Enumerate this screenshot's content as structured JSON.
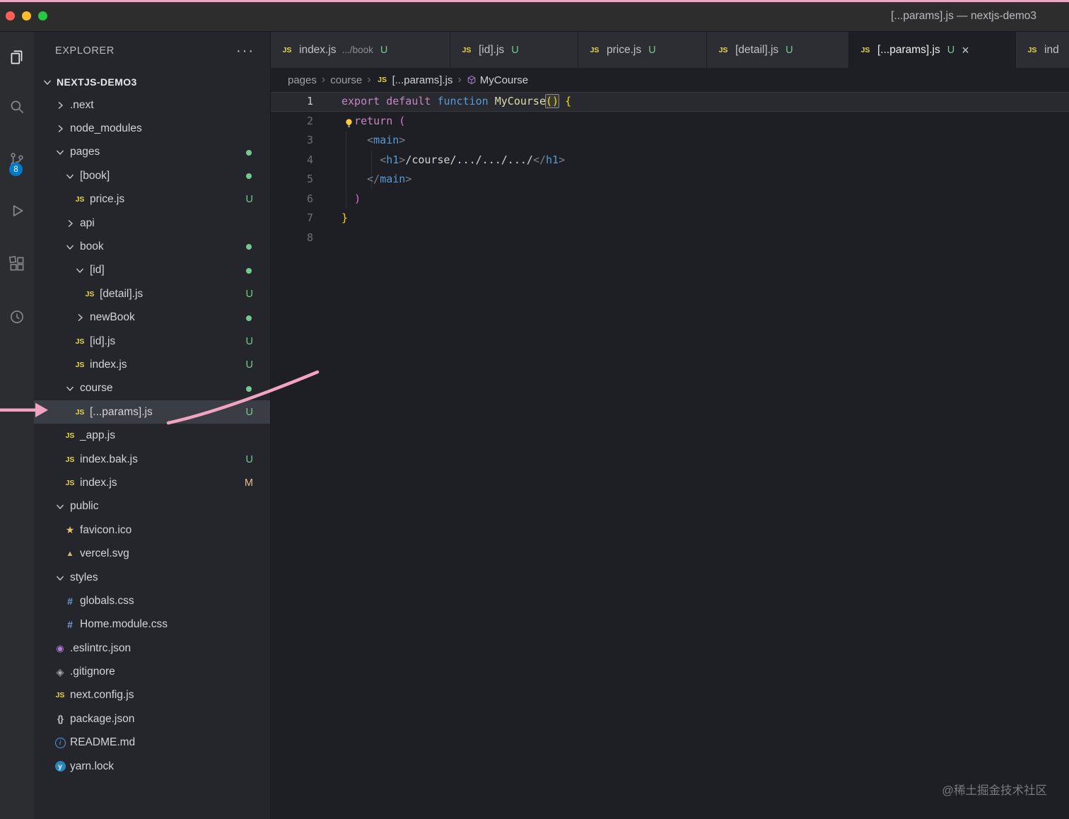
{
  "window": {
    "title": "[...params].js — nextjs-demo3"
  },
  "activity_bar": {
    "source_control_badge": "8",
    "items": [
      {
        "name": "explorer",
        "active": true
      },
      {
        "name": "search"
      },
      {
        "name": "source-control",
        "badge": "8"
      },
      {
        "name": "run-debug"
      },
      {
        "name": "extensions"
      },
      {
        "name": "history"
      }
    ]
  },
  "sidebar": {
    "header": "EXPLORER",
    "actions": "···",
    "root": {
      "label": "NEXTJS-DEMO3",
      "expanded": true
    },
    "items": [
      {
        "label": ".next",
        "level": 0,
        "type": "folder",
        "expanded": false
      },
      {
        "label": "node_modules",
        "level": 0,
        "type": "folder",
        "expanded": false
      },
      {
        "label": "pages",
        "level": 0,
        "type": "folder",
        "expanded": true,
        "dot": true
      },
      {
        "label": "[book]",
        "level": 1,
        "type": "folder",
        "expanded": true,
        "dot": true
      },
      {
        "label": "price.js",
        "level": 2,
        "type": "file",
        "icon": "js",
        "badge": "U"
      },
      {
        "label": "api",
        "level": 1,
        "type": "folder",
        "expanded": false
      },
      {
        "label": "book",
        "level": 1,
        "type": "folder",
        "expanded": true,
        "dot": true
      },
      {
        "label": "[id]",
        "level": 2,
        "type": "folder",
        "expanded": true,
        "dot": true
      },
      {
        "label": "[detail].js",
        "level": 3,
        "type": "file",
        "icon": "js",
        "badge": "U"
      },
      {
        "label": "newBook",
        "level": 2,
        "type": "folder",
        "expanded": false,
        "dot": true
      },
      {
        "label": "[id].js",
        "level": 2,
        "type": "file",
        "icon": "js",
        "badge": "U"
      },
      {
        "label": "index.js",
        "level": 2,
        "type": "file",
        "icon": "js",
        "badge": "U"
      },
      {
        "label": "course",
        "level": 1,
        "type": "folder",
        "expanded": true,
        "dot": true
      },
      {
        "label": "[...params].js",
        "level": 2,
        "type": "file",
        "icon": "js",
        "badge": "U",
        "selected": true
      },
      {
        "label": "_app.js",
        "level": 1,
        "type": "file",
        "icon": "js"
      },
      {
        "label": "index.bak.js",
        "level": 1,
        "type": "file",
        "icon": "js",
        "badge": "U"
      },
      {
        "label": "index.js",
        "level": 1,
        "type": "file",
        "icon": "js",
        "badge": "M"
      },
      {
        "label": "public",
        "level": 0,
        "type": "folder",
        "expanded": true
      },
      {
        "label": "favicon.ico",
        "level": 1,
        "type": "file",
        "icon": "star"
      },
      {
        "label": "vercel.svg",
        "level": 1,
        "type": "file",
        "icon": "vercel"
      },
      {
        "label": "styles",
        "level": 0,
        "type": "folder",
        "expanded": true
      },
      {
        "label": "globals.css",
        "level": 1,
        "type": "file",
        "icon": "css"
      },
      {
        "label": "Home.module.css",
        "level": 1,
        "type": "file",
        "icon": "css"
      },
      {
        "label": ".eslintrc.json",
        "level": 0,
        "type": "file",
        "icon": "eslint"
      },
      {
        "label": ".gitignore",
        "level": 0,
        "type": "file",
        "icon": "git"
      },
      {
        "label": "next.config.js",
        "level": 0,
        "type": "file",
        "icon": "js"
      },
      {
        "label": "package.json",
        "level": 0,
        "type": "file",
        "icon": "braces"
      },
      {
        "label": "README.md",
        "level": 0,
        "type": "file",
        "icon": "info"
      },
      {
        "label": "yarn.lock",
        "level": 0,
        "type": "file",
        "icon": "yarn"
      }
    ]
  },
  "tabs": [
    {
      "name": "index.js",
      "desc": ".../book",
      "badge": "U"
    },
    {
      "name": "[id].js",
      "badge": "U"
    },
    {
      "name": "price.js",
      "badge": "U"
    },
    {
      "name": "[detail].js",
      "badge": "U"
    },
    {
      "name": "[...params].js",
      "badge": "U",
      "active": true,
      "close": "×"
    },
    {
      "name": "ind",
      "partial": true
    }
  ],
  "breadcrumb": {
    "items": [
      {
        "label": "pages"
      },
      {
        "label": "course"
      },
      {
        "label": "[...params].js",
        "icon": "js"
      },
      {
        "label": "MyCourse",
        "icon": "symbol"
      }
    ]
  },
  "editor": {
    "lines": [
      {
        "n": 1,
        "current": true,
        "tokens": [
          [
            "k",
            "export"
          ],
          [
            "d",
            " "
          ],
          [
            "k",
            "default"
          ],
          [
            "d",
            " "
          ],
          [
            "kb",
            "function"
          ],
          [
            "d",
            " "
          ],
          [
            "fn",
            "MyCourse"
          ],
          [
            "box",
            "()"
          ],
          [
            "d",
            " "
          ],
          [
            "b1",
            "{"
          ]
        ]
      },
      {
        "n": 2,
        "lightbulb": true,
        "tokens": [
          [
            "d",
            "  "
          ],
          [
            "k",
            "return"
          ],
          [
            "d",
            " "
          ],
          [
            "b2",
            "("
          ]
        ]
      },
      {
        "n": 3,
        "tokens": [
          [
            "d",
            "    "
          ],
          [
            "pn",
            "<"
          ],
          [
            "tag",
            "main"
          ],
          [
            "pn",
            ">"
          ]
        ]
      },
      {
        "n": 4,
        "tokens": [
          [
            "d",
            "      "
          ],
          [
            "pn",
            "<"
          ],
          [
            "tag",
            "h1"
          ],
          [
            "pn",
            ">"
          ],
          [
            "tx",
            "/course/.../.../.../"
          ],
          [
            "pn",
            "</"
          ],
          [
            "tag",
            "h1"
          ],
          [
            "pn",
            ">"
          ]
        ]
      },
      {
        "n": 5,
        "tokens": [
          [
            "d",
            "    "
          ],
          [
            "pn",
            "</"
          ],
          [
            "tag",
            "main"
          ],
          [
            "pn",
            ">"
          ]
        ]
      },
      {
        "n": 6,
        "tokens": [
          [
            "d",
            "  "
          ],
          [
            "b2",
            ")"
          ]
        ]
      },
      {
        "n": 7,
        "tokens": [
          [
            "b1",
            "}"
          ]
        ]
      },
      {
        "n": 8,
        "tokens": []
      }
    ]
  },
  "watermark": "@稀土掘金技术社区",
  "colors": {
    "git_untracked": "#73c991",
    "git_modified": "#e2c08d",
    "scm_badge": "#007acc",
    "js_icon": "#e8d44d",
    "annotation_pink": "#f2a3c1"
  }
}
